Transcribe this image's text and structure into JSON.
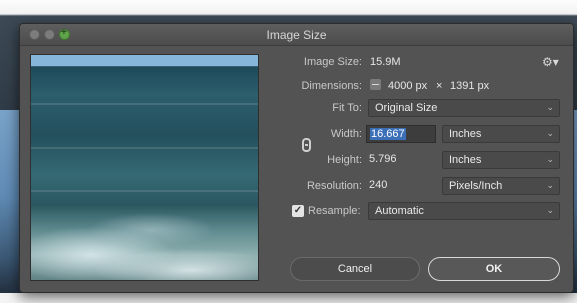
{
  "window": {
    "title": "Image Size"
  },
  "image_size": {
    "label": "Image Size:",
    "value": "15.9M"
  },
  "dimensions": {
    "label": "Dimensions:",
    "width": "4000 px",
    "times": "×",
    "height": "1391 px"
  },
  "fit_to": {
    "label": "Fit To:",
    "value": "Original Size"
  },
  "width": {
    "label": "Width:",
    "value": "16.667",
    "unit": "Inches"
  },
  "height": {
    "label": "Height:",
    "value": "5.796",
    "unit": "Inches"
  },
  "resolution": {
    "label": "Resolution:",
    "value": "240",
    "unit": "Pixels/Inch"
  },
  "resample": {
    "label": "Resample:",
    "checked": true,
    "check_glyph": "✓",
    "value": "Automatic"
  },
  "buttons": {
    "cancel": "Cancel",
    "ok": "OK"
  },
  "icons": {
    "gear": "gear-icon",
    "chevron": "chevron-down-icon",
    "link": "link-chain-icon"
  },
  "colors": {
    "dialog_bg": "#535353",
    "selection": "#3b6fb8",
    "zoom_button": "#5fa24a"
  }
}
